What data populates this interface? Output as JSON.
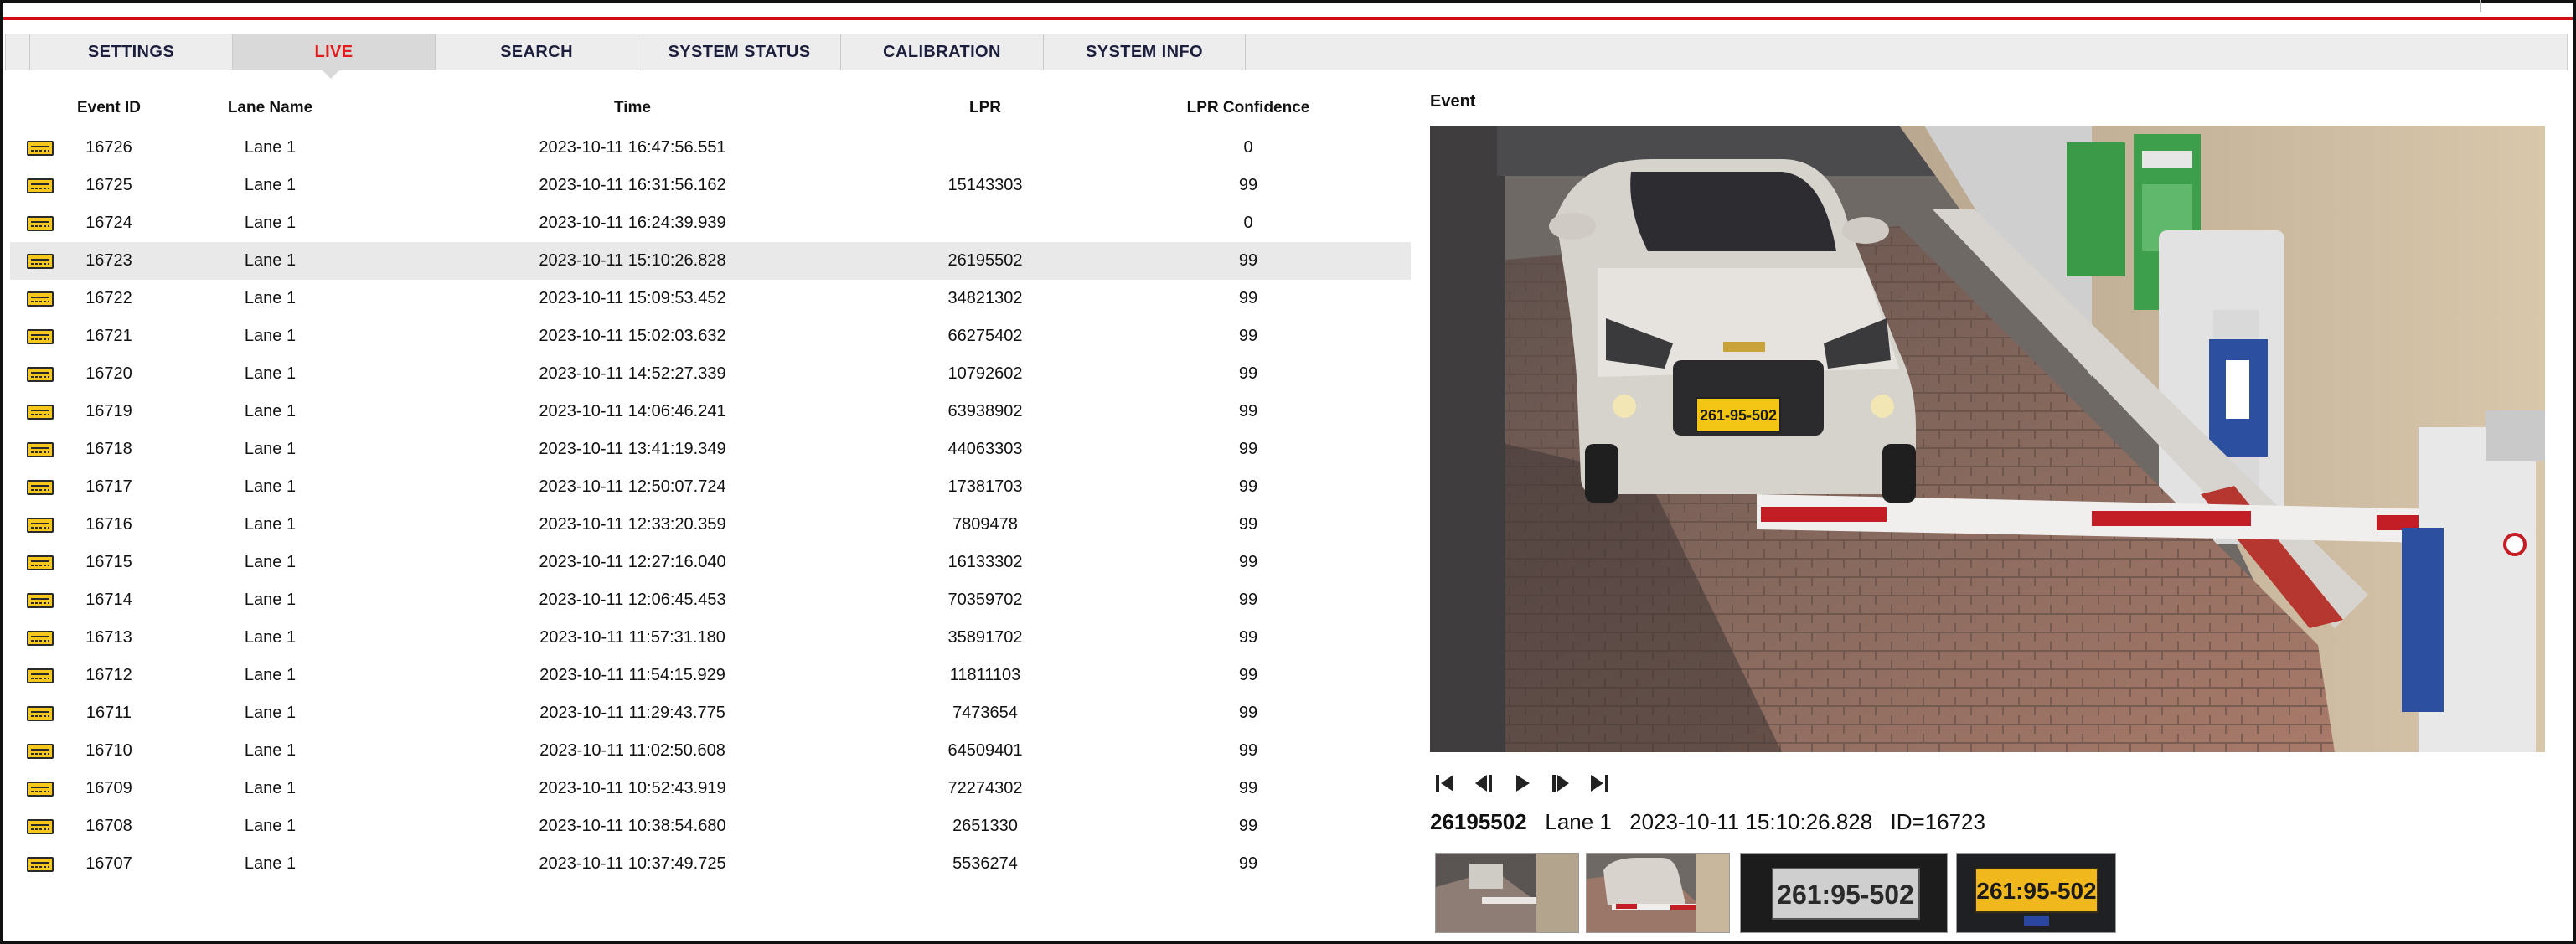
{
  "tabs": [
    "SETTINGS",
    "LIVE",
    "SEARCH",
    "SYSTEM STATUS",
    "CALIBRATION",
    "SYSTEM INFO"
  ],
  "active_tab": "LIVE",
  "table": {
    "headers": [
      "Event ID",
      "Lane Name",
      "Time",
      "LPR",
      "LPR Confidence"
    ],
    "rows": [
      {
        "id": "16726",
        "lane": "Lane 1",
        "time": "2023-10-11 16:47:56.551",
        "lpr": "",
        "conf": "0"
      },
      {
        "id": "16725",
        "lane": "Lane 1",
        "time": "2023-10-11 16:31:56.162",
        "lpr": "15143303",
        "conf": "99"
      },
      {
        "id": "16724",
        "lane": "Lane 1",
        "time": "2023-10-11 16:24:39.939",
        "lpr": "",
        "conf": "0"
      },
      {
        "id": "16723",
        "lane": "Lane 1",
        "time": "2023-10-11 15:10:26.828",
        "lpr": "26195502",
        "conf": "99",
        "selected": true
      },
      {
        "id": "16722",
        "lane": "Lane 1",
        "time": "2023-10-11 15:09:53.452",
        "lpr": "34821302",
        "conf": "99"
      },
      {
        "id": "16721",
        "lane": "Lane 1",
        "time": "2023-10-11 15:02:03.632",
        "lpr": "66275402",
        "conf": "99"
      },
      {
        "id": "16720",
        "lane": "Lane 1",
        "time": "2023-10-11 14:52:27.339",
        "lpr": "10792602",
        "conf": "99"
      },
      {
        "id": "16719",
        "lane": "Lane 1",
        "time": "2023-10-11 14:06:46.241",
        "lpr": "63938902",
        "conf": "99"
      },
      {
        "id": "16718",
        "lane": "Lane 1",
        "time": "2023-10-11 13:41:19.349",
        "lpr": "44063303",
        "conf": "99"
      },
      {
        "id": "16717",
        "lane": "Lane 1",
        "time": "2023-10-11 12:50:07.724",
        "lpr": "17381703",
        "conf": "99"
      },
      {
        "id": "16716",
        "lane": "Lane 1",
        "time": "2023-10-11 12:33:20.359",
        "lpr": "7809478",
        "conf": "99"
      },
      {
        "id": "16715",
        "lane": "Lane 1",
        "time": "2023-10-11 12:27:16.040",
        "lpr": "16133302",
        "conf": "99"
      },
      {
        "id": "16714",
        "lane": "Lane 1",
        "time": "2023-10-11 12:06:45.453",
        "lpr": "70359702",
        "conf": "99"
      },
      {
        "id": "16713",
        "lane": "Lane 1",
        "time": "2023-10-11 11:57:31.180",
        "lpr": "35891702",
        "conf": "99"
      },
      {
        "id": "16712",
        "lane": "Lane 1",
        "time": "2023-10-11 11:54:15.929",
        "lpr": "11811103",
        "conf": "99"
      },
      {
        "id": "16711",
        "lane": "Lane 1",
        "time": "2023-10-11 11:29:43.775",
        "lpr": "7473654",
        "conf": "99"
      },
      {
        "id": "16710",
        "lane": "Lane 1",
        "time": "2023-10-11 11:02:50.608",
        "lpr": "64509401",
        "conf": "99"
      },
      {
        "id": "16709",
        "lane": "Lane 1",
        "time": "2023-10-11 10:52:43.919",
        "lpr": "72274302",
        "conf": "99"
      },
      {
        "id": "16708",
        "lane": "Lane 1",
        "time": "2023-10-11 10:38:54.680",
        "lpr": "2651330",
        "conf": "99"
      },
      {
        "id": "16707",
        "lane": "Lane 1",
        "time": "2023-10-11 10:37:49.725",
        "lpr": "5536274",
        "conf": "99"
      }
    ]
  },
  "event": {
    "title": "Event",
    "plate": "26195502",
    "lane": "Lane 1",
    "time": "2023-10-11 15:10:26.828",
    "id_label": "ID=16723",
    "plate_text_in_image": "261-95-502",
    "thumb_plate_text": "261:95-502",
    "controls": [
      "first-frame-icon",
      "prev-frame-icon",
      "play-icon",
      "next-frame-icon",
      "last-frame-icon"
    ]
  },
  "colors": {
    "accent_red": "#d10f12",
    "tab_text": "#1b1e3d",
    "plate_yellow": "#f6c81c"
  }
}
